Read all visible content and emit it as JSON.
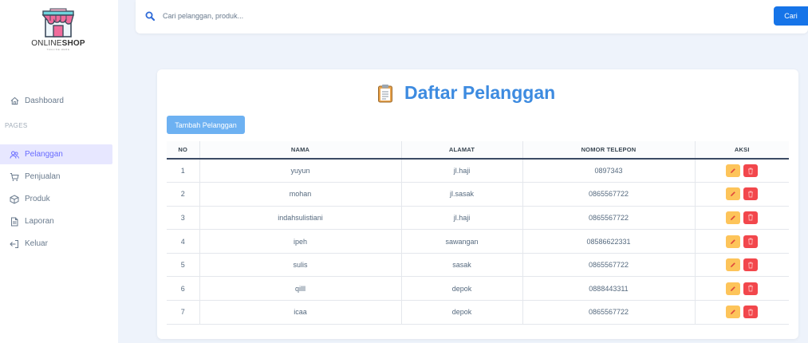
{
  "brand": {
    "name_bold": "SHOP",
    "name_thin": "ONLINE",
    "tagline": "TAGLINE HERE"
  },
  "sidebar": {
    "items_top": [
      {
        "label": "Dashboard",
        "icon": "home-icon"
      }
    ],
    "section_header": "PAGES",
    "items": [
      {
        "label": "Pelanggan",
        "icon": "users-icon",
        "active": true
      },
      {
        "label": "Penjualan",
        "icon": "cart-icon"
      },
      {
        "label": "Produk",
        "icon": "box-icon"
      },
      {
        "label": "Laporan",
        "icon": "document-icon"
      },
      {
        "label": "Keluar",
        "icon": "logout-icon"
      }
    ]
  },
  "search": {
    "placeholder": "Cari pelanggan, produk...",
    "button_label": "Cari"
  },
  "page": {
    "title": "Daftar Pelanggan",
    "add_button_label": "Tambah Pelanggan"
  },
  "table": {
    "headers": [
      "NO",
      "NAMA",
      "ALAMAT",
      "NOMOR TELEPON",
      "AKSI"
    ],
    "rows": [
      {
        "no": "1",
        "nama": "yuyun",
        "alamat": "jl.haji",
        "telepon": "0897343"
      },
      {
        "no": "2",
        "nama": "mohan",
        "alamat": "jl.sasak",
        "telepon": "0865567722"
      },
      {
        "no": "3",
        "nama": "indahsulistiani",
        "alamat": "jl.haji",
        "telepon": "0865567722"
      },
      {
        "no": "4",
        "nama": "ipeh",
        "alamat": "sawangan",
        "telepon": "08586622331"
      },
      {
        "no": "5",
        "nama": "sulis",
        "alamat": "sasak",
        "telepon": "0865567722"
      },
      {
        "no": "6",
        "nama": "qilll",
        "alamat": "depok",
        "telepon": "0888443311"
      },
      {
        "no": "7",
        "nama": "icaa",
        "alamat": "depok",
        "telepon": "0865567722"
      }
    ]
  },
  "colors": {
    "accent": "#696cff",
    "primary_button": "#1674e8",
    "title": "#3d8be0",
    "edit": "#fdc45a",
    "delete": "#f2474c"
  }
}
